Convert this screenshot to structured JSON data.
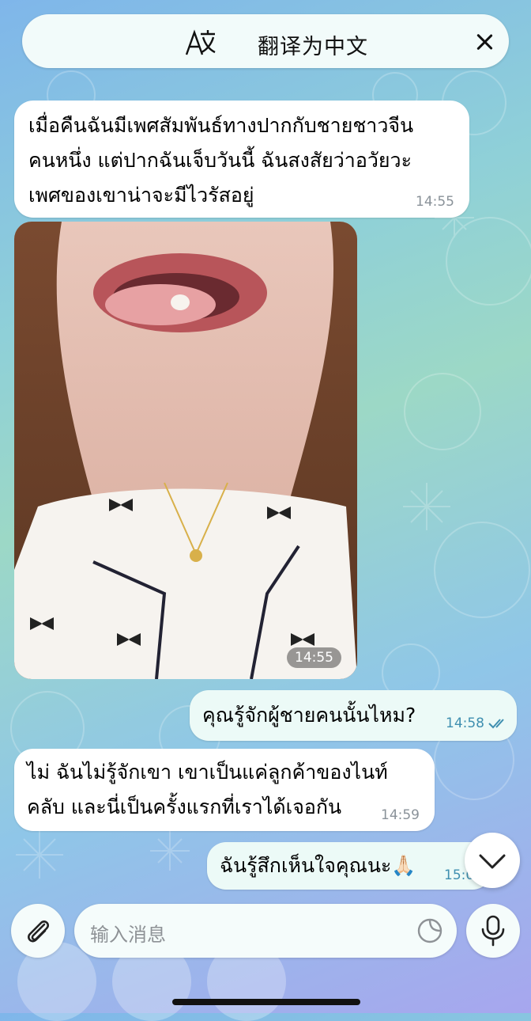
{
  "header": {
    "translate_label": "翻译为中文",
    "translate_icon": "translate-icon",
    "close_icon": "close-icon"
  },
  "messages": [
    {
      "direction": "incoming",
      "lines": [
        "เมื่อคืนฉันมีเพศสัมพันธ์ทางปากกับชายชาวจีน",
        "คนหนึ่ง แต่ปากฉันเจ็บวันนี้ ฉันสงสัยว่าอวัยวะ",
        "เพศของเขาน่าจะมีไวรัสอยู่"
      ],
      "time": "14:55"
    },
    {
      "direction": "incoming",
      "type": "photo",
      "time": "14:55"
    },
    {
      "direction": "outgoing",
      "lines": [
        "คุณรู้จักผู้ชายคนนั้นไหม?"
      ],
      "time": "14:58",
      "status": "read-checkmarks"
    },
    {
      "direction": "incoming",
      "lines": [
        "ไม่ ฉันไม่รู้จักเขา เขาเป็นแค่ลูกค้าของไนท์",
        "คลับ และนี่เป็นครั้งแรกที่เราได้เจอกัน"
      ],
      "time": "14:59"
    },
    {
      "direction": "outgoing",
      "lines": [
        "ฉันรู้สึกเห็นใจคุณนะ🙏🏻"
      ],
      "time": "15:0"
    }
  ],
  "composer": {
    "placeholder": "输入消息",
    "attach_icon": "paperclip-icon",
    "sticker_icon": "sticker-icon",
    "mic_icon": "microphone-icon",
    "scroll_icon": "chevron-down-icon"
  },
  "colors": {
    "incoming_bubble": "#ffffff",
    "outgoing_bubble": "#ecfaf7",
    "outgoing_time": "#3f8fb0"
  }
}
